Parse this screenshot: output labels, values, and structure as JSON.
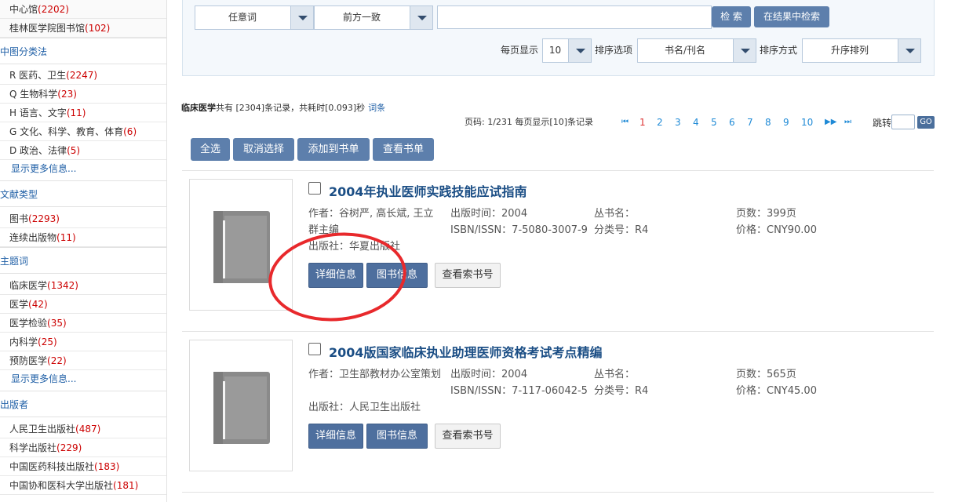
{
  "sidebar": {
    "top_items": [
      {
        "label": "中心馆",
        "count": "(2202)"
      },
      {
        "label": "桂林医学院图书馆",
        "count": "(102)"
      }
    ],
    "sections": [
      {
        "heading": "中图分类法",
        "items": [
          {
            "label": "R 医药、卫生",
            "count": "(2247)"
          },
          {
            "label": "Q 生物科学",
            "count": "(23)"
          },
          {
            "label": "H 语言、文字",
            "count": "(11)"
          },
          {
            "label": "G 文化、科学、教育、体育",
            "count": "(6)"
          },
          {
            "label": "D 政治、法律",
            "count": "(5)"
          }
        ],
        "more": "显示更多信息..."
      },
      {
        "heading": "文献类型",
        "items": [
          {
            "label": "图书",
            "count": "(2293)"
          },
          {
            "label": "连续出版物",
            "count": "(11)"
          }
        ]
      },
      {
        "heading": "主题词",
        "items": [
          {
            "label": "临床医学",
            "count": "(1342)"
          },
          {
            "label": "医学",
            "count": "(42)"
          },
          {
            "label": "医学检验",
            "count": "(35)"
          },
          {
            "label": "内科学",
            "count": "(25)"
          },
          {
            "label": "预防医学",
            "count": "(22)"
          }
        ],
        "more": "显示更多信息..."
      },
      {
        "heading": "出版者",
        "items": [
          {
            "label": "人民卫生出版社",
            "count": "(487)"
          },
          {
            "label": "科学出版社",
            "count": "(229)"
          },
          {
            "label": "中国医药科技出版社",
            "count": "(183)"
          },
          {
            "label": "中国协和医科大学出版社",
            "count": "(181)"
          }
        ]
      }
    ]
  },
  "search": {
    "field_select": "任意词",
    "match_select": "前方一致",
    "query_value": "",
    "search_button": "检 索",
    "refine_button": "在结果中检索",
    "per_page_label": "每页显示",
    "per_page_value": "10",
    "sort_label": "排序选项",
    "sort_value": "书名/刊名",
    "order_label": "排序方式",
    "order_value": "升序排列"
  },
  "results": {
    "summary_term": "临床医学",
    "summary_text": "共有 [2304]条记录，共耗时[0.093]秒",
    "summary_link": "词条",
    "page_info": "页码: 1/231 每页显示[10]条记录",
    "pager": {
      "first": "⏮",
      "prev": "◀◀",
      "pages": [
        "1",
        "2",
        "3",
        "4",
        "5",
        "6",
        "7",
        "8",
        "9",
        "10"
      ],
      "current": "1",
      "next": "▶▶",
      "last": "⏭"
    },
    "jump_label": "跳转",
    "go_label": "GO"
  },
  "actions": {
    "select_all": "全选",
    "deselect": "取消选择",
    "add_to_list": "添加到书单",
    "view_list": "查看书单"
  },
  "records": [
    {
      "title": "2004年执业医师实践技能应试指南",
      "author_label": "作者：谷树严, 高长斌, 王立群主编",
      "publisher": "出版社：华夏出版社",
      "pub_time": "出版时间：2004",
      "isbn": "ISBN/ISSN：7-5080-3007-9",
      "series": "丛书名：",
      "class_no": "分类号：R4",
      "pages": "页数：399页",
      "price": "价格：CNY90.00",
      "btn_detail": "详细信息",
      "btn_book": "图书信息",
      "btn_call": "查看索书号"
    },
    {
      "title": "2004版国家临床执业助理医师资格考试考点精编",
      "author_label": "作者：卫生部教材办公室策划",
      "publisher": "出版社：人民卫生出版社",
      "pub_time": "出版时间：2004",
      "isbn": "ISBN/ISSN：7-117-06042-5",
      "series": "丛书名：",
      "class_no": "分类号：R4",
      "pages": "页数：565页",
      "price": "价格：CNY45.00",
      "btn_detail": "详细信息",
      "btn_book": "图书信息",
      "btn_call": "查看索书号"
    }
  ],
  "colors": {
    "button_blue": "#5d7fac",
    "link_blue": "#1f5fa6",
    "count_red": "#cc0000",
    "annotation_red": "#e8292c"
  }
}
